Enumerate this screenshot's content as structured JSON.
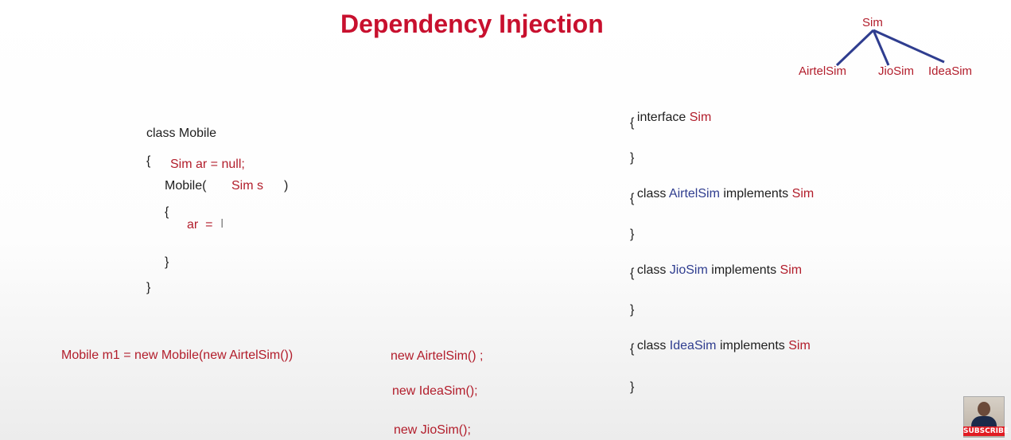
{
  "title": "Dependency Injection",
  "hierarchy": {
    "root": "Sim",
    "children": [
      "AirtelSim",
      "JioSim",
      "IdeaSim"
    ]
  },
  "mobile_class": {
    "line1": "class Mobile",
    "open_brace": "{",
    "field": "Sim ar = null;",
    "ctor_name": "Mobile(",
    "ctor_param": "Sim s",
    "ctor_close": ")",
    "ctor_open": "{",
    "assign": "ar  =",
    "cursor": "I",
    "ctor_end": "}",
    "class_end": "}"
  },
  "instantiation": "Mobile m1 = new Mobile(new AirtelSim())",
  "news": [
    "new AirtelSim() ;",
    "new IdeaSim();",
    "new JioSim();"
  ],
  "interfaces": {
    "interface_kw": "interface",
    "interface_name": "Sim",
    "class_kw": "class",
    "implements_kw": "implements",
    "open": "{",
    "close": "}",
    "classes": [
      "AirtelSim",
      "JioSim",
      "IdeaSim"
    ]
  },
  "subscribe_label": "SUBSCRIBE",
  "colors": {
    "title": "#c8102e",
    "keyword_red": "#b21d2b",
    "class_blue": "#2f3d8f"
  }
}
